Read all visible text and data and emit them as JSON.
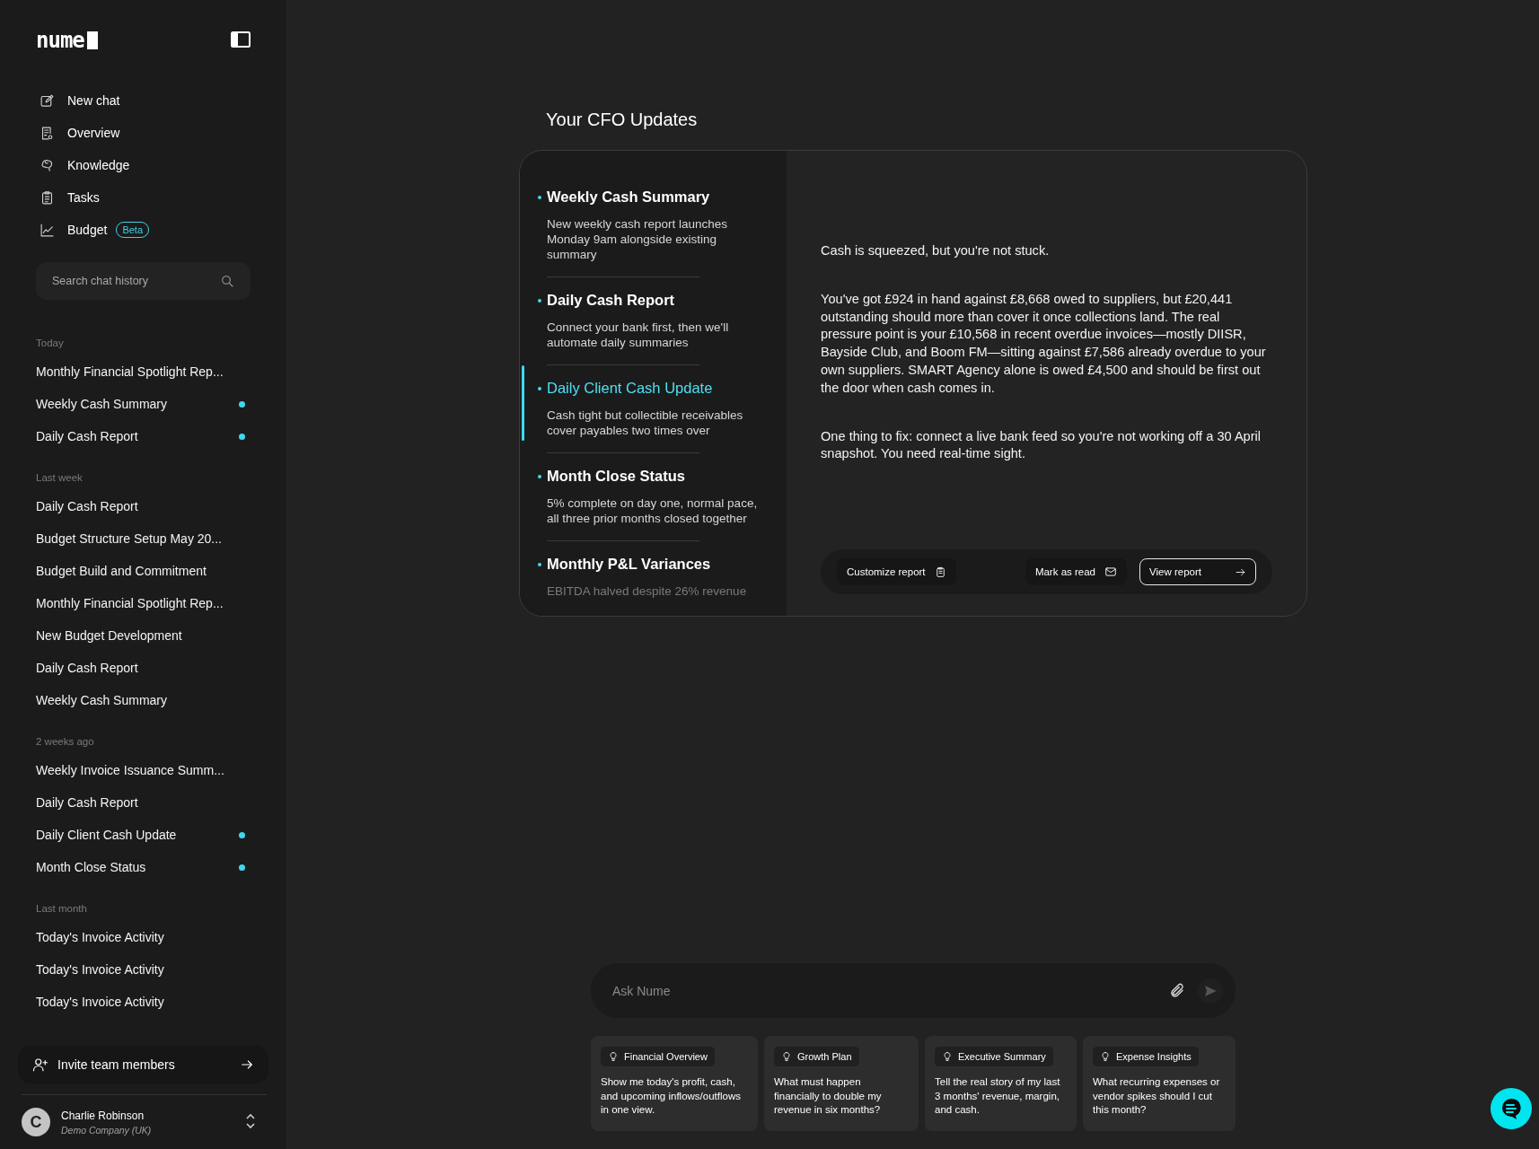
{
  "sidebar": {
    "logo": "nume",
    "nav": [
      {
        "label": "New chat"
      },
      {
        "label": "Overview"
      },
      {
        "label": "Knowledge"
      },
      {
        "label": "Tasks"
      },
      {
        "label": "Budget",
        "badge": "Beta"
      }
    ],
    "search": {
      "placeholder": "Search chat history"
    },
    "history": [
      {
        "label": "Today",
        "items": [
          {
            "title": "Monthly Financial Spotlight Rep...",
            "unread": false
          },
          {
            "title": "Weekly Cash Summary",
            "unread": true
          },
          {
            "title": "Daily Cash Report",
            "unread": true
          }
        ]
      },
      {
        "label": "Last week",
        "items": [
          {
            "title": "Daily Cash Report",
            "unread": false
          },
          {
            "title": "Budget Structure Setup May 20...",
            "unread": false
          },
          {
            "title": "Budget Build and Commitment",
            "unread": false
          },
          {
            "title": "Monthly Financial Spotlight Rep...",
            "unread": false
          },
          {
            "title": "New Budget Development",
            "unread": false
          },
          {
            "title": "Daily Cash Report",
            "unread": false
          },
          {
            "title": "Weekly Cash Summary",
            "unread": false
          }
        ]
      },
      {
        "label": "2 weeks ago",
        "items": [
          {
            "title": "Weekly Invoice Issuance Summ...",
            "unread": false
          },
          {
            "title": "Daily Cash Report",
            "unread": false
          },
          {
            "title": "Daily Client Cash Update",
            "unread": true
          },
          {
            "title": "Month Close Status",
            "unread": true
          }
        ]
      },
      {
        "label": "Last month",
        "items": [
          {
            "title": "Today's Invoice Activity",
            "unread": false
          },
          {
            "title": "Today's Invoice Activity",
            "unread": false
          },
          {
            "title": "Today's Invoice Activity",
            "unread": false
          }
        ]
      }
    ],
    "invite": "Invite team members",
    "user": {
      "initial": "C",
      "name": "Charlie Robinson",
      "company": "Demo Company (UK)"
    }
  },
  "main": {
    "title": "Your CFO Updates",
    "updates": [
      {
        "title": "Weekly Cash Summary",
        "summary": "New weekly cash report launches Monday 9am alongside existing summary",
        "selected": false
      },
      {
        "title": "Daily Cash Report",
        "summary": "Connect your bank first, then we'll automate daily summaries",
        "selected": false
      },
      {
        "title": "Daily Client Cash Update",
        "summary": "Cash tight but collectible receivables cover payables two times over",
        "selected": true
      },
      {
        "title": "Month Close Status",
        "summary": "5% complete on day one, normal pace, all three prior months closed together",
        "selected": false
      },
      {
        "title": "Monthly P&L Variances",
        "summary": "EBITDA halved despite 26% revenue",
        "selected": false
      }
    ],
    "detail": {
      "paragraphs": [
        "Cash is squeezed, but you're not stuck.",
        "You've got £924 in hand against £8,668 owed to suppliers, but £20,441 outstanding should more than cover it once collections land. The real pressure point is your £10,568 in recent overdue invoices—mostly DIISR, Bayside Club, and Boom FM—sitting against £7,586 already overdue to your own suppliers. SMART Agency alone is owed £4,500 and should be first out the door when cash comes in.",
        "One thing to fix: connect a live bank feed so you're not working off a 30 April snapshot. You need real-time sight."
      ],
      "actions": [
        {
          "label": "Customize report",
          "kind": "ghost"
        },
        {
          "label": "Mark as read",
          "kind": "ghost"
        },
        {
          "label": "View report",
          "kind": "outline"
        }
      ]
    }
  },
  "composer": {
    "placeholder": "Ask Nume"
  },
  "suggestions": [
    {
      "tag": "Financial Overview",
      "prompt": "Show me today's profit, cash, and upcoming inflows/outflows in one view."
    },
    {
      "tag": "Growth Plan",
      "prompt": "What must happen financially to double my revenue in six months?"
    },
    {
      "tag": "Executive Summary",
      "prompt": "Tell the real story of my last 3 months' revenue, margin, and cash."
    },
    {
      "tag": "Expense Insights",
      "prompt": "What recurring expenses or vendor spikes should I cut this month?"
    }
  ]
}
